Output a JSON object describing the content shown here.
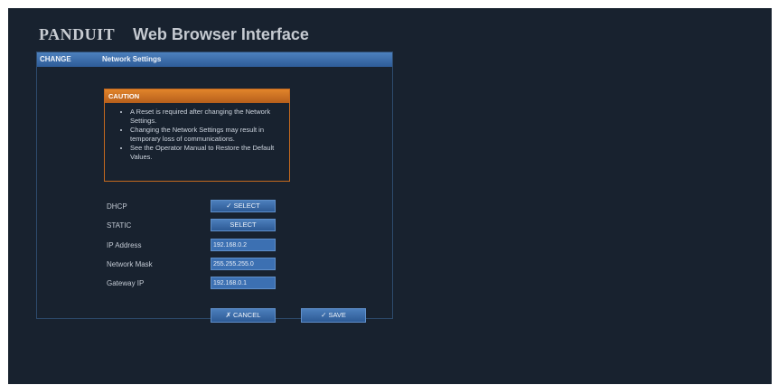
{
  "header": {
    "logo": "PANDUIT",
    "title": "Web Browser Interface"
  },
  "panel": {
    "bar_left": "CHANGE",
    "bar_title": "Network Settings"
  },
  "caution": {
    "title": "CAUTION",
    "items": [
      "A Reset is required after changing the Network Settings.",
      "Changing the Network Settings may result in temporary loss of communications.",
      "See the Operator Manual to Restore the Default Values."
    ]
  },
  "form": {
    "dhcp_label": "DHCP",
    "dhcp_button": "✓ SELECT",
    "static_label": "STATIC",
    "static_button": "SELECT",
    "ip_label": "IP Address",
    "ip_value": "192.168.0.2",
    "mask_label": "Network Mask",
    "mask_value": "255.255.255.0",
    "gateway_label": "Gateway IP",
    "gateway_value": "192.168.0.1"
  },
  "actions": {
    "cancel": "✗ CANCEL",
    "save": "✓ SAVE"
  },
  "colors": {
    "background": "#18222f",
    "accent_blue": "#3c70b2",
    "caution_orange": "#d1741f"
  }
}
